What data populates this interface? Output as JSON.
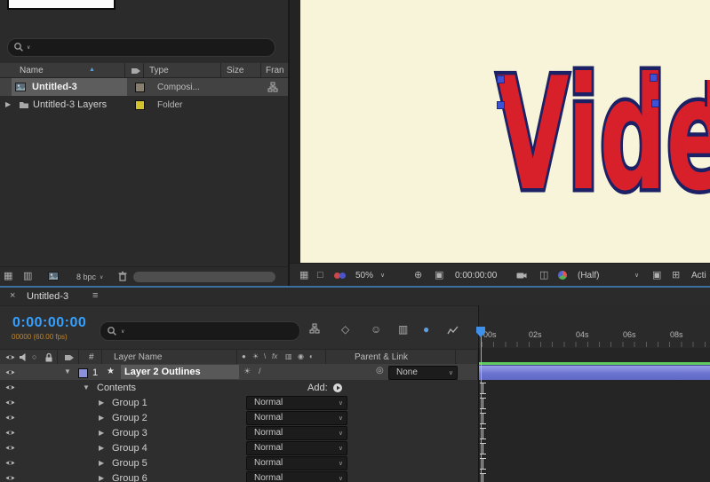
{
  "icons": {
    "chevron": "∨",
    "sort_asc": "▲",
    "triangle_right": "▶",
    "triangle_down": "▼",
    "star": "★",
    "close": "×",
    "menu": "≡",
    "grid": "▦",
    "rows_icon": "▥",
    "monitor": "□",
    "crosshair": "⊕",
    "roi": "▣",
    "overlay": "◫",
    "plus_grid": "⊞",
    "cube": "◇",
    "shy": "☺",
    "blend_icon": "▥",
    "motion_blur": "●",
    "solo": "○",
    "dot": "●",
    "sun": "☀",
    "backslash": "\\",
    "fx": "fx",
    "circle_dot": "◉",
    "half_circle": "◐",
    "slash": "/",
    "pickwhip": "◎"
  },
  "project": {
    "columns": {
      "name": "Name",
      "type": "Type",
      "size": "Size",
      "frame": "Fran"
    },
    "rows": [
      {
        "name": "Untitled-3",
        "type": "Composi...",
        "selected": true
      },
      {
        "name": "Untitled-3 Layers",
        "type": "Folder",
        "selected": false
      }
    ],
    "footer": {
      "bpc": "8 bpc"
    }
  },
  "viewer": {
    "canvas_text": "Vide",
    "zoom": "50%",
    "timecode": "0:00:00:00",
    "resolution": "(Half)",
    "trailing": "Acti"
  },
  "timeline": {
    "tab": "Untitled-3",
    "timecode": "0:00:00:00",
    "frames": "00000 (60.00 fps)",
    "ruler": [
      "00s",
      "02s",
      "04s",
      "06s",
      "08s"
    ],
    "header": {
      "hash": "#",
      "layer_name": "Layer Name",
      "parent": "Parent & Link"
    },
    "layer": {
      "index": "1",
      "name": "Layer 2 Outlines",
      "parent": "None"
    },
    "contents": {
      "label": "Contents",
      "add": "Add:"
    },
    "groups": [
      {
        "name": "Group 1",
        "mode": "Normal"
      },
      {
        "name": "Group 2",
        "mode": "Normal"
      },
      {
        "name": "Group 3",
        "mode": "Normal"
      },
      {
        "name": "Group 4",
        "mode": "Normal"
      },
      {
        "name": "Group 5",
        "mode": "Normal"
      },
      {
        "name": "Group 6",
        "mode": "Normal"
      }
    ]
  }
}
